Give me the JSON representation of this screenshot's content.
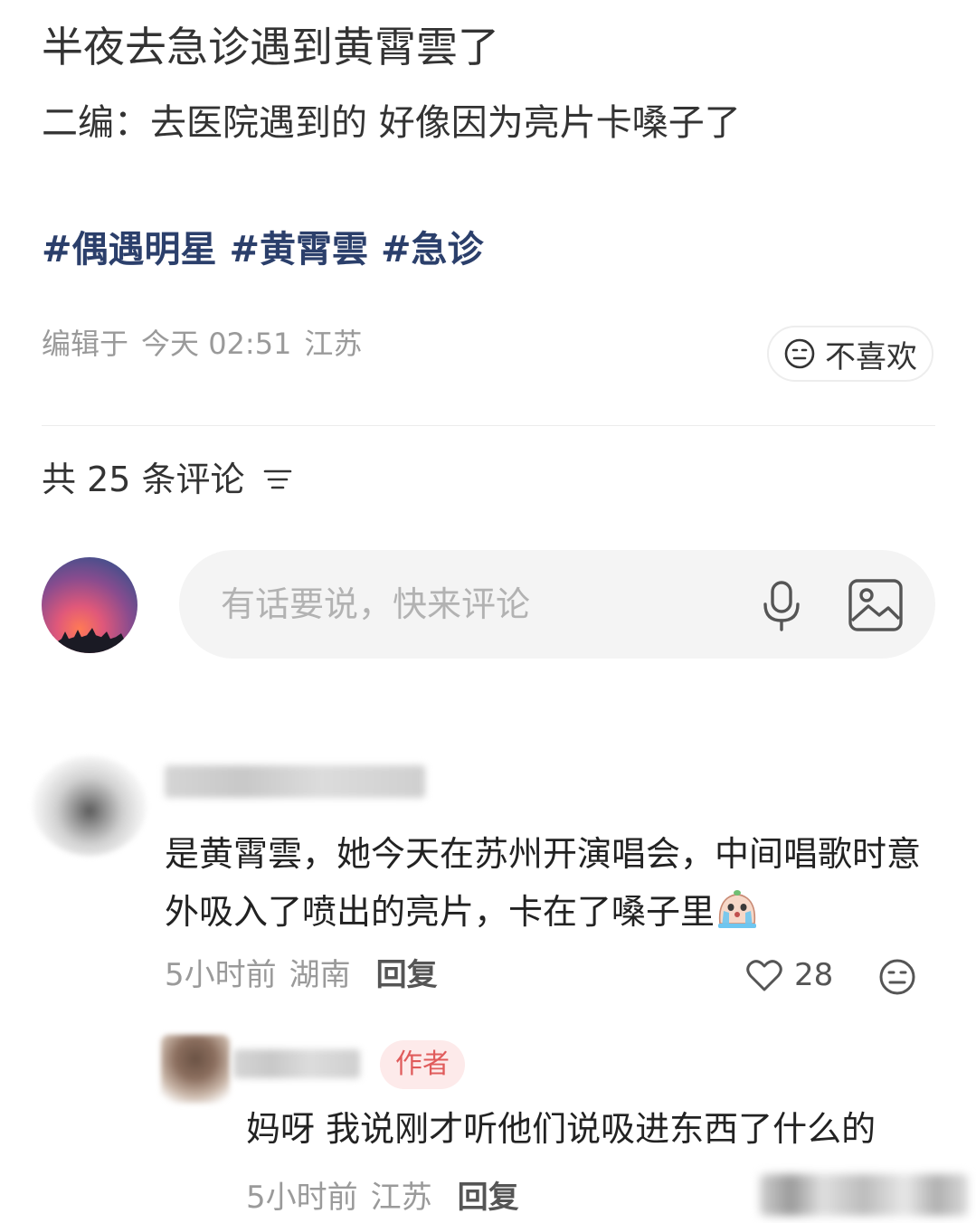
{
  "post": {
    "title": "半夜去急诊遇到黄霄雲了",
    "edit_note": "二编：去医院遇到的 好像因为亮片卡嗓子了",
    "tags": [
      "#偶遇明星",
      "#黄霄雲",
      "#急诊"
    ],
    "meta": {
      "edited_label": "编辑于",
      "time": "今天 02:51",
      "location": "江苏"
    },
    "dislike_label": "不喜欢"
  },
  "comments_section": {
    "header": "共 25 条评论",
    "input_placeholder": "有话要说，快来评论"
  },
  "comments": [
    {
      "text": "是黄霄雲，她今天在苏州开演唱会，中间唱歌时意外吸入了喷出的亮片，卡在了嗓子里",
      "time": "5小时前",
      "location": "湖南",
      "reply_label": "回复",
      "likes": "28",
      "emoji": "crying-emoji"
    },
    {
      "badge": "作者",
      "text": "妈呀 我说刚才听他们说吸进东西了什么的",
      "time": "5小时前",
      "location": "江苏",
      "reply_label": "回复"
    }
  ],
  "colors": {
    "tag": "#2b3f6b",
    "meta_gray": "#9a9a9a",
    "author_badge_bg": "#fdeaea",
    "author_badge_text": "#e05b5b",
    "input_bg": "#f4f4f4"
  }
}
